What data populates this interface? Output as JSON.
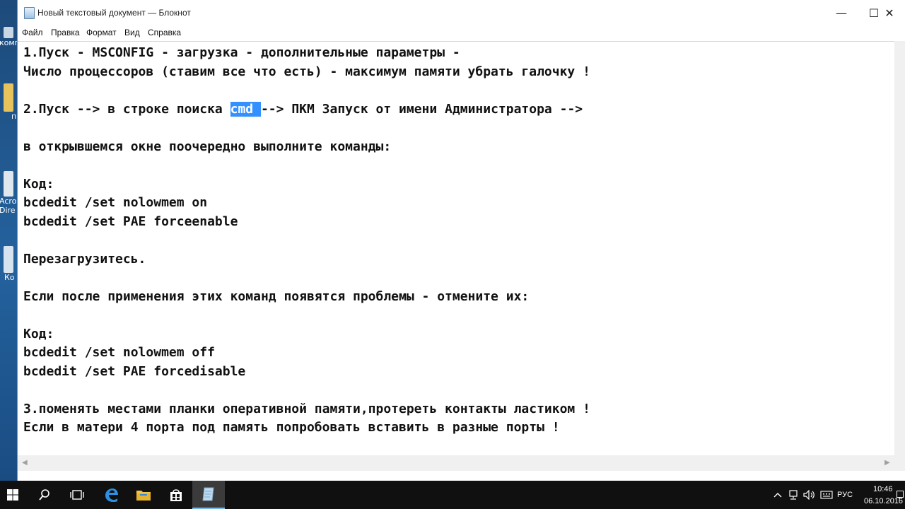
{
  "window": {
    "title": "Новый текстовый документ — Блокнот",
    "minimize": "—",
    "maximize": "☐",
    "close": "✕"
  },
  "menu": [
    "Файл",
    "Правка",
    "Формат",
    "Вид",
    "Справка"
  ],
  "desktop_labels": [
    "комп",
    "п",
    "Acro",
    "Dire",
    "Ко"
  ],
  "editor": {
    "lines": [
      "1.Пуск - MSCONFIG - загрузка - дополнительные параметры -",
      "Число процессоров (ставим все что есть) - максимум памяти убрать галочку !",
      "",
      "",
      "",
      "в открывшемся окне поочередно выполните команды:",
      "",
      "Код:",
      "bcdedit /set nolowmem on",
      "bcdedit /set PAE forceenable",
      "",
      "Перезагрузитесь.",
      "",
      "Если после применения этих команд появятся проблемы - отмените их:",
      "",
      "Код:",
      "bcdedit /set nolowmem off",
      "bcdedit /set PAE forcedisable",
      "",
      "3.поменять местами планки оперативной памяти,протереть контакты ластиком !",
      "Если в матери 4 порта под память попробовать вставить в разные порты !"
    ],
    "line3_before": "2.Пуск --> в строке поиска ",
    "line3_selected": "cmd ",
    "line3_after": "--> ПКМ Запуск от имени Администратора -->"
  },
  "taskbar": {
    "language": "РУС",
    "time": "10:46",
    "date": "06.10.2016"
  },
  "colors": {
    "selection": "#3390ff",
    "taskbar": "#101010",
    "active_accent": "#76b9ed"
  }
}
